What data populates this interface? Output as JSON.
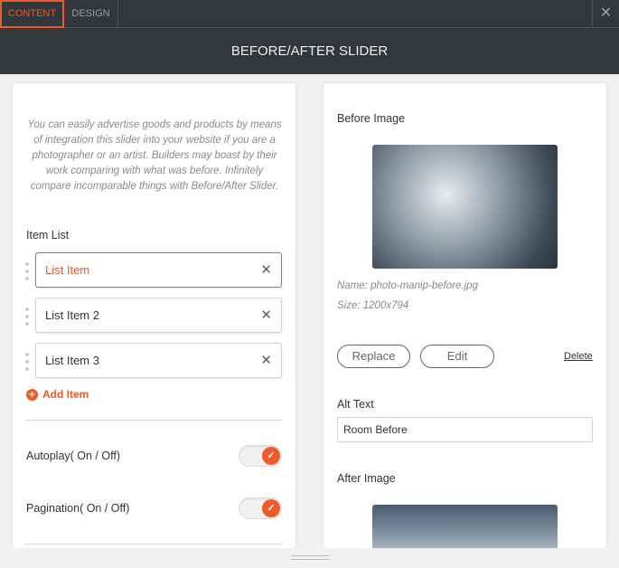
{
  "tabs": [
    {
      "label": "CONTENT",
      "active": true
    },
    {
      "label": "DESIGN",
      "active": false
    }
  ],
  "header": {
    "title": "BEFORE/AFTER SLIDER"
  },
  "left": {
    "description": "You can easily advertise goods and products by means of integration this slider into your website if you are a photographer or an artist. Builders may boast by their work comparing with what was before. Infinitely compare incomparable things with Before/After Slider.",
    "item_list_label": "Item List",
    "items": [
      {
        "label": "List Item"
      },
      {
        "label": "List Item 2"
      },
      {
        "label": "List Item 3"
      }
    ],
    "add_item": "Add Item",
    "autoplay_label": "Autoplay( On / Off)",
    "autoplay_on": true,
    "pagination_label": "Pagination( On / Off)",
    "pagination_on": true
  },
  "right": {
    "before_label": "Before Image",
    "name": "Name: photo-manip-before.jpg",
    "size": "Size: 1200x794",
    "replace": "Replace",
    "edit": "Edit",
    "delete": "Delete",
    "alt_label": "Alt Text",
    "alt_value": "Room Before",
    "after_label": "After Image"
  },
  "colors": {
    "accent": "#f05a2a",
    "dark": "#31373a"
  }
}
